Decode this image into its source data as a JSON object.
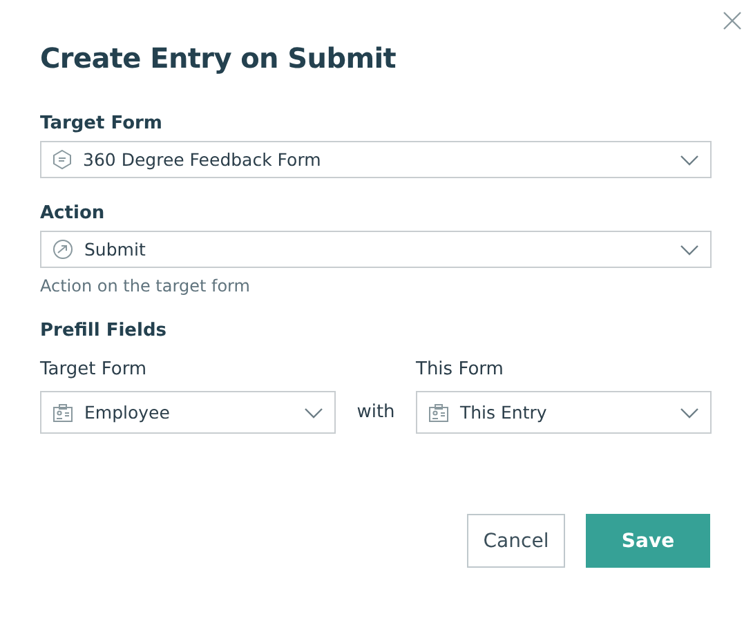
{
  "dialog": {
    "title": "Create Entry on Submit"
  },
  "target_form": {
    "label": "Target Form",
    "value": "360 Degree Feedback Form"
  },
  "action": {
    "label": "Action",
    "value": "Submit",
    "hint": "Action on the target form"
  },
  "prefill": {
    "label": "Prefill Fields",
    "joiner": "with",
    "pairs": [
      {
        "label": "Target Form",
        "value": "Employee"
      },
      {
        "label": "This Form",
        "value": "This Entry"
      }
    ]
  },
  "buttons": [
    {
      "label": "Cancel",
      "kind": "secondary"
    },
    {
      "label": "Save",
      "kind": "primary"
    }
  ]
}
